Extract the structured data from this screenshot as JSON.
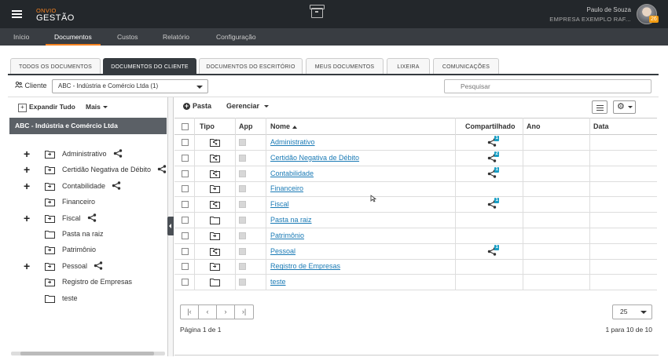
{
  "app": {
    "brand_top": "ONVIO",
    "brand_bottom": "GESTÃO"
  },
  "user": {
    "name": "Paulo de Souza",
    "company": "EMPRESA EXEMPLO RAF...",
    "badge": "26"
  },
  "nav": [
    "Início",
    "Documentos",
    "Custos",
    "Relatório",
    "Configuração"
  ],
  "tabs": [
    "TODOS OS DOCUMENTOS",
    "DOCUMENTOS DO CLIENTE",
    "DOCUMENTOS DO ESCRITÓRIO",
    "MEUS DOCUMENTOS",
    "LIXEIRA",
    "COMUNICAÇÕES"
  ],
  "client": {
    "label": "Cliente",
    "value": "ABC - Indústria e Comércio Ltda (1)"
  },
  "search": {
    "placeholder": "Pesquisar"
  },
  "left": {
    "expand": "Expandir Tudo",
    "more": "Mais",
    "header": "ABC - Indústria e Comércio Ltda"
  },
  "tree": [
    {
      "label": "Administrativo",
      "expandable": true,
      "shared": true
    },
    {
      "label": "Certidão Negativa de Débito",
      "expandable": true,
      "shared": true
    },
    {
      "label": "Contabilidade",
      "expandable": true,
      "shared": true
    },
    {
      "label": "Financeiro",
      "expandable": false,
      "shared": false
    },
    {
      "label": "Fiscal",
      "expandable": true,
      "shared": true
    },
    {
      "label": "Pasta na raiz",
      "expandable": false,
      "shared": false
    },
    {
      "label": "Patrimônio",
      "expandable": false,
      "shared": false
    },
    {
      "label": "Pessoal",
      "expandable": true,
      "shared": true
    },
    {
      "label": "Registro de Empresas",
      "expandable": false,
      "shared": false
    },
    {
      "label": "teste",
      "expandable": false,
      "shared": false
    }
  ],
  "toolbar": {
    "add": "Pasta",
    "manage": "Gerenciar"
  },
  "table": {
    "headers": [
      "Tipo",
      "App",
      "Nome",
      "Compartilhado",
      "Ano",
      "Data"
    ],
    "rows": [
      {
        "name": "Administrativo",
        "icon": "shared-folder-icon",
        "share": "1"
      },
      {
        "name": "Certidão Negativa de Débito",
        "icon": "shared-folder-icon",
        "share": "2"
      },
      {
        "name": "Contabilidade",
        "icon": "shared-folder-icon",
        "share": "1"
      },
      {
        "name": "Financeiro",
        "icon": "link-folder-icon",
        "share": ""
      },
      {
        "name": "Fiscal",
        "icon": "shared-folder-icon",
        "share": "1"
      },
      {
        "name": "Pasta na raiz",
        "icon": "folder-icon",
        "share": ""
      },
      {
        "name": "Patrimônio",
        "icon": "link-folder-icon",
        "share": ""
      },
      {
        "name": "Pessoal",
        "icon": "shared-folder-icon",
        "share": "1"
      },
      {
        "name": "Registro de Empresas",
        "icon": "link-folder-icon",
        "share": ""
      },
      {
        "name": "teste",
        "icon": "folder-icon",
        "share": ""
      }
    ]
  },
  "pager": {
    "page_info": "Página 1 de 1",
    "range_info": "1 para 10 de 10",
    "page_size": "25"
  },
  "colors": {
    "accent": "#f58220",
    "link": "#1a7ab5",
    "badge": "#1a9fc5"
  }
}
